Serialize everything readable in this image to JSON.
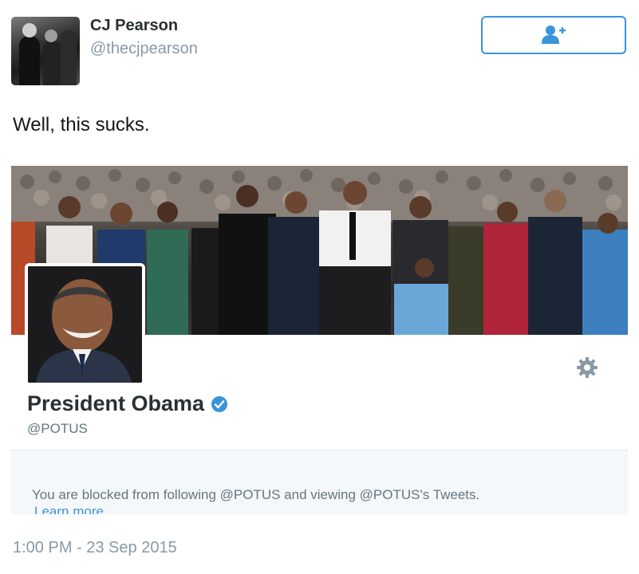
{
  "tweet": {
    "user_name": "CJ Pearson",
    "user_handle": "@thecjpearson",
    "text": "Well, this sucks.",
    "timestamp": "1:00 PM - 23 Sep 2015"
  },
  "follow_button": {
    "icon": "add-user-icon"
  },
  "profile_card": {
    "name": "President Obama",
    "handle": "@POTUS",
    "verified": true,
    "settings_icon": "gear-icon",
    "blocked_message": "You are blocked from following @POTUS and viewing @POTUS's Tweets.",
    "learn_more": "Learn more"
  },
  "colors": {
    "accent": "#3b94d9",
    "muted_text": "#8899a6",
    "blocked_bg": "#f5f8fa"
  }
}
